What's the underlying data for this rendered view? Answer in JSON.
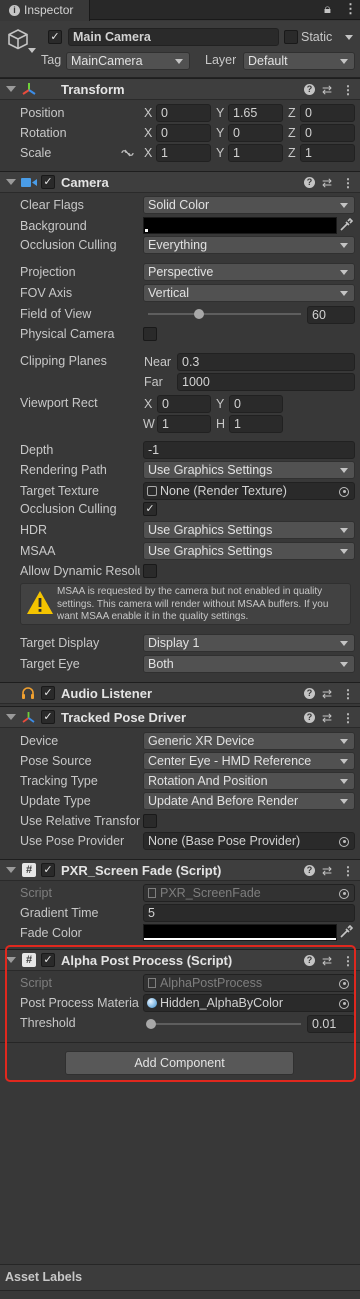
{
  "tab": {
    "title": "Inspector"
  },
  "object": {
    "name": "Main Camera",
    "static_label": "Static",
    "tag_label": "Tag",
    "tag_value": "MainCamera",
    "layer_label": "Layer",
    "layer_value": "Default",
    "active": true
  },
  "transform": {
    "title": "Transform",
    "position_label": "Position",
    "rotation_label": "Rotation",
    "scale_label": "Scale",
    "x": "X",
    "y": "Y",
    "z": "Z",
    "position": [
      "0",
      "1.65",
      "0"
    ],
    "rotation": [
      "0",
      "0",
      "0"
    ],
    "scale": [
      "1",
      "1",
      "1"
    ]
  },
  "camera": {
    "title": "Camera",
    "clear_flags": {
      "label": "Clear Flags",
      "value": "Solid Color"
    },
    "background": {
      "label": "Background",
      "color": "#000000"
    },
    "occlusion_culling_mask": {
      "label": "Occlusion Culling",
      "value": "Everything"
    },
    "projection": {
      "label": "Projection",
      "value": "Perspective"
    },
    "fov_axis": {
      "label": "FOV Axis",
      "value": "Vertical"
    },
    "field_of_view": {
      "label": "Field of View",
      "value": "60",
      "fraction": 0.3
    },
    "physical_camera": {
      "label": "Physical Camera",
      "checked": false
    },
    "clipping": {
      "label": "Clipping Planes",
      "near_label": "Near",
      "near": "0.3",
      "far_label": "Far",
      "far": "1000"
    },
    "viewport": {
      "label": "Viewport Rect",
      "x_label": "X",
      "x": "0",
      "y_label": "Y",
      "y": "0",
      "w_label": "W",
      "w": "1",
      "h_label": "H",
      "h": "1"
    },
    "depth": {
      "label": "Depth",
      "value": "-1"
    },
    "rendering_path": {
      "label": "Rendering Path",
      "value": "Use Graphics Settings"
    },
    "target_texture": {
      "label": "Target Texture",
      "value": "None (Render Texture)"
    },
    "occlusion_culling": {
      "label": "Occlusion Culling",
      "checked": true
    },
    "hdr": {
      "label": "HDR",
      "value": "Use Graphics Settings"
    },
    "msaa": {
      "label": "MSAA",
      "value": "Use Graphics Settings"
    },
    "dynamic_resolution": {
      "label": "Allow Dynamic Resolu",
      "checked": false
    },
    "warning": "MSAA is requested by the camera but not enabled in quality settings. This camera will render without MSAA buffers. If you want MSAA enable it in the quality settings.",
    "target_display": {
      "label": "Target Display",
      "value": "Display 1"
    },
    "target_eye": {
      "label": "Target Eye",
      "value": "Both"
    }
  },
  "audio_listener": {
    "title": "Audio Listener"
  },
  "tracked_pose": {
    "title": "Tracked Pose Driver",
    "device": {
      "label": "Device",
      "value": "Generic XR Device"
    },
    "pose_source": {
      "label": "Pose Source",
      "value": "Center Eye - HMD Reference"
    },
    "tracking_type": {
      "label": "Tracking Type",
      "value": "Rotation And Position"
    },
    "update_type": {
      "label": "Update Type",
      "value": "Update And Before Render"
    },
    "use_relative": {
      "label": "Use Relative Transfor",
      "checked": false
    },
    "use_pose_provider": {
      "label": "Use Pose Provider",
      "value": "None (Base Pose Provider)"
    }
  },
  "screen_fade": {
    "title": "PXR_Screen Fade (Script)",
    "script": {
      "label": "Script",
      "value": "PXR_ScreenFade"
    },
    "gradient_time": {
      "label": "Gradient Time",
      "value": "5"
    },
    "fade_color": {
      "label": "Fade Color",
      "color": "#000000"
    }
  },
  "alpha_post": {
    "title": "Alpha Post Process (Script)",
    "script": {
      "label": "Script",
      "value": "AlphaPostProcess"
    },
    "material": {
      "label": "Post Process Materia",
      "value": "Hidden_AlphaByColor"
    },
    "threshold": {
      "label": "Threshold",
      "value": "0.01",
      "fraction": 0.01
    }
  },
  "add_component": "Add Component",
  "asset_labels": "Asset Labels",
  "colors": {
    "highlight": "#e0281e",
    "warning": "#f5c400"
  }
}
